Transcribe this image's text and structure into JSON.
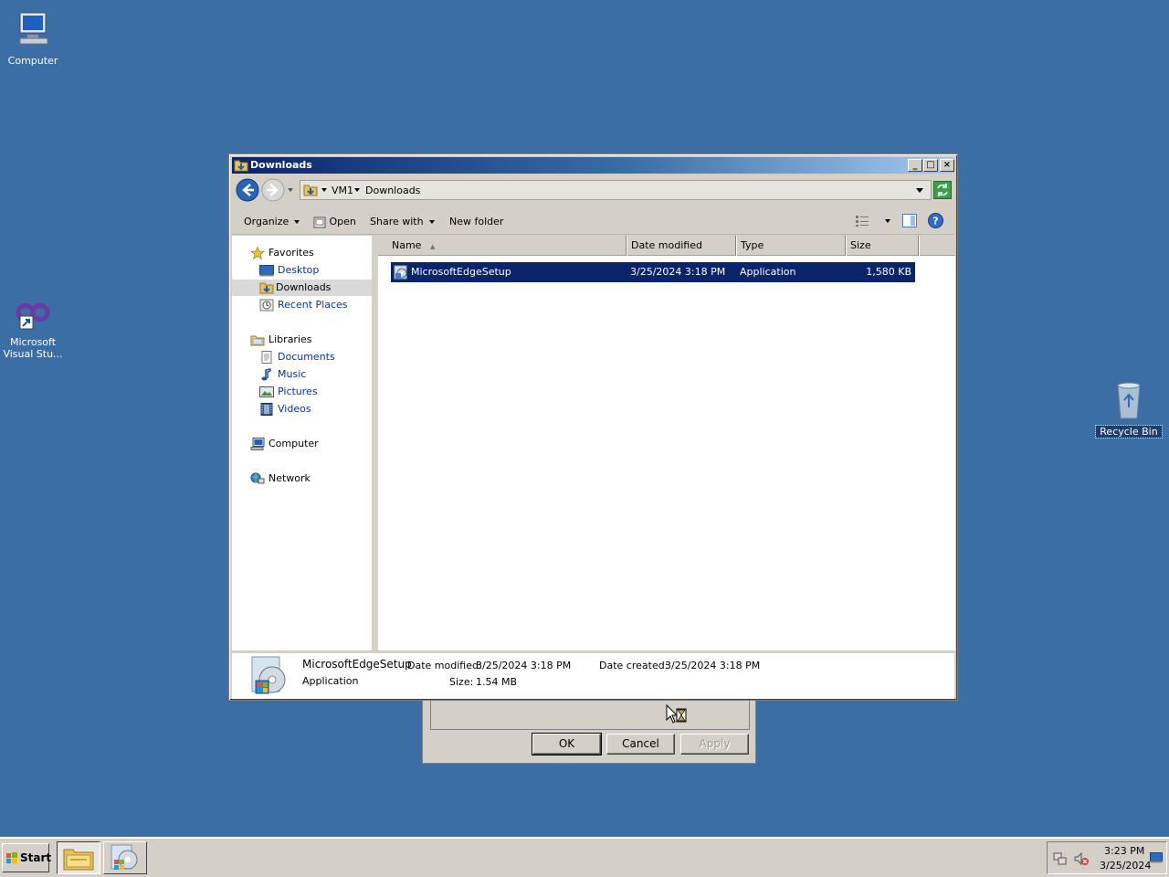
{
  "desktop": {
    "icons": [
      {
        "label": "Computer"
      },
      {
        "label": "Microsoft\nVisual Stu..."
      },
      {
        "label": "Recycle Bin"
      }
    ]
  },
  "background_dialog": {
    "ok_label": "OK",
    "cancel_label": "Cancel",
    "apply_label": "Apply"
  },
  "window": {
    "title": "Downloads",
    "breadcrumb": [
      "VM1",
      "Downloads"
    ],
    "toolbar": {
      "organize": "Organize",
      "open": "Open",
      "share_with": "Share with",
      "new_folder": "New folder"
    },
    "nav": {
      "favorites": {
        "label": "Favorites",
        "items": [
          {
            "label": "Desktop"
          },
          {
            "label": "Downloads"
          },
          {
            "label": "Recent Places"
          }
        ]
      },
      "libraries": {
        "label": "Libraries",
        "items": [
          {
            "label": "Documents"
          },
          {
            "label": "Music"
          },
          {
            "label": "Pictures"
          },
          {
            "label": "Videos"
          }
        ]
      },
      "computer": "Computer",
      "network": "Network"
    },
    "columns": [
      "Name",
      "Date modified",
      "Type",
      "Size"
    ],
    "files": [
      {
        "name": "MicrosoftEdgeSetup",
        "date_modified": "3/25/2024 3:18 PM",
        "type": "Application",
        "size": "1,580 KB"
      }
    ],
    "details": {
      "name": "MicrosoftEdgeSetup",
      "type": "Application",
      "date_modified_label": "Date modified:",
      "date_modified": "3/25/2024 3:18 PM",
      "size_label": "Size:",
      "size": "1.54 MB",
      "date_created_label": "Date created:",
      "date_created": "3/25/2024 3:18 PM"
    }
  },
  "taskbar": {
    "start_label": "Start",
    "clock_time": "3:23 PM",
    "clock_date": "3/25/2024"
  },
  "colors": {
    "desktop": "#3a6ea5",
    "selection": "#0a246a",
    "title_gradient_start": "#0a246a",
    "title_gradient_end": "#a6caf0"
  }
}
